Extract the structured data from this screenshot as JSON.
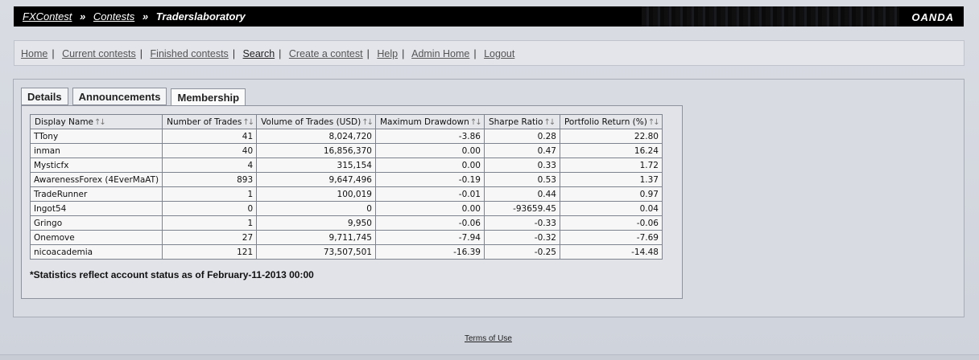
{
  "header": {
    "breadcrumb": [
      "FXContest",
      "Contests",
      "Traderslaboratory"
    ],
    "separator": "»",
    "logo": "OANDA"
  },
  "nav": {
    "items": [
      "Home",
      "Current contests",
      "Finished contests",
      "Search",
      "Create a contest",
      "Help",
      "Admin Home",
      "Logout"
    ],
    "separator": "|"
  },
  "tabs": [
    "Details",
    "Announcements",
    "Membership"
  ],
  "active_tab": "Membership",
  "table": {
    "columns": [
      "Display Name",
      "Number of Trades",
      "Volume of Trades (USD)",
      "Maximum Drawdown",
      "Sharpe Ratio",
      "Portfolio Return (%)"
    ],
    "sort_icon": "sort-arrows-icon",
    "rows": [
      [
        "TTony",
        "41",
        "8,024,720",
        "-3.86",
        "0.28",
        "22.80"
      ],
      [
        "inman",
        "40",
        "16,856,370",
        "0.00",
        "0.47",
        "16.24"
      ],
      [
        "Mysticfx",
        "4",
        "315,154",
        "0.00",
        "0.33",
        "1.72"
      ],
      [
        "AwarenessForex (4EverMaAT)",
        "893",
        "9,647,496",
        "-0.19",
        "0.53",
        "1.37"
      ],
      [
        "TradeRunner",
        "1",
        "100,019",
        "-0.01",
        "0.44",
        "0.97"
      ],
      [
        "Ingot54",
        "0",
        "0",
        "0.00",
        "-93659.45",
        "0.04"
      ],
      [
        "Gringo",
        "1",
        "9,950",
        "-0.06",
        "-0.33",
        "-0.06"
      ],
      [
        "Onemove",
        "27",
        "9,711,745",
        "-7.94",
        "-0.32",
        "-7.69"
      ],
      [
        "nicoacademia",
        "121",
        "73,507,501",
        "-16.39",
        "-0.25",
        "-14.48"
      ]
    ]
  },
  "footnote": "*Statistics reflect account status as of February-11-2013 00:00",
  "footer": {
    "terms": "Terms of Use"
  },
  "colors": {
    "header_bg": "#000000",
    "page_bg": "#c8ccd5",
    "panel_bg": "#d8dbe1"
  }
}
